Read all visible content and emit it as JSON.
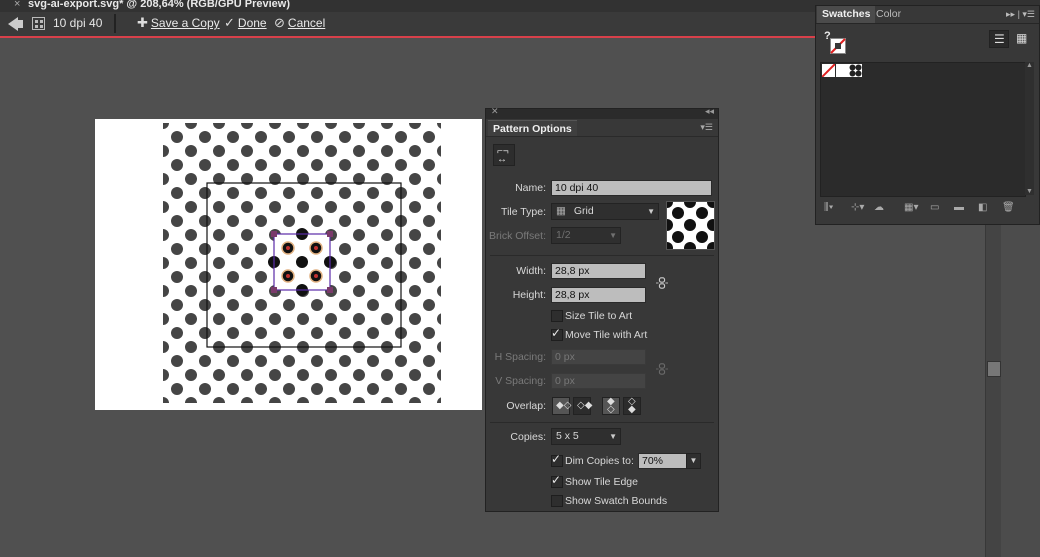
{
  "window": {
    "close_glyph": "×",
    "doc_title": "svg-ai-export.svg* @ 208,64% (RGB/GPU Preview)"
  },
  "isolation_bar": {
    "pattern_name": "10 dpi 40",
    "save_copy": "Save a Copy",
    "done": "Done",
    "cancel": "Cancel",
    "accent_color": "#d8404a"
  },
  "canvas": {
    "background": "#505050",
    "artboard_color": "#ffffff",
    "dot_color": "#454545"
  },
  "pattern_options": {
    "title": "Pattern Options",
    "name_label": "Name:",
    "name_value": "10 dpi 40",
    "tile_type_label": "Tile Type:",
    "tile_type_value": "Grid",
    "brick_offset_label": "Brick Offset:",
    "brick_offset_value": "1/2",
    "width_label": "Width:",
    "width_value": "28,8 px",
    "height_label": "Height:",
    "height_value": "28,8 px",
    "size_tile_to_art": "Size Tile to Art",
    "size_tile_to_art_checked": false,
    "move_tile_with_art": "Move Tile with Art",
    "move_tile_with_art_checked": true,
    "h_spacing_label": "H Spacing:",
    "h_spacing_value": "0 px",
    "v_spacing_label": "V Spacing:",
    "v_spacing_value": "0 px",
    "overlap_label": "Overlap:",
    "copies_label": "Copies:",
    "copies_value": "5 x 5",
    "dim_copies_label": "Dim Copies to:",
    "dim_copies_checked": true,
    "dim_copies_value": "70%",
    "show_tile_edge": "Show Tile Edge",
    "show_tile_edge_checked": true,
    "show_swatch_bounds": "Show Swatch Bounds",
    "show_swatch_bounds_checked": false
  },
  "swatches_panel": {
    "tab_swatches": "Swatches",
    "tab_color": "Color",
    "help_glyph": "?"
  }
}
